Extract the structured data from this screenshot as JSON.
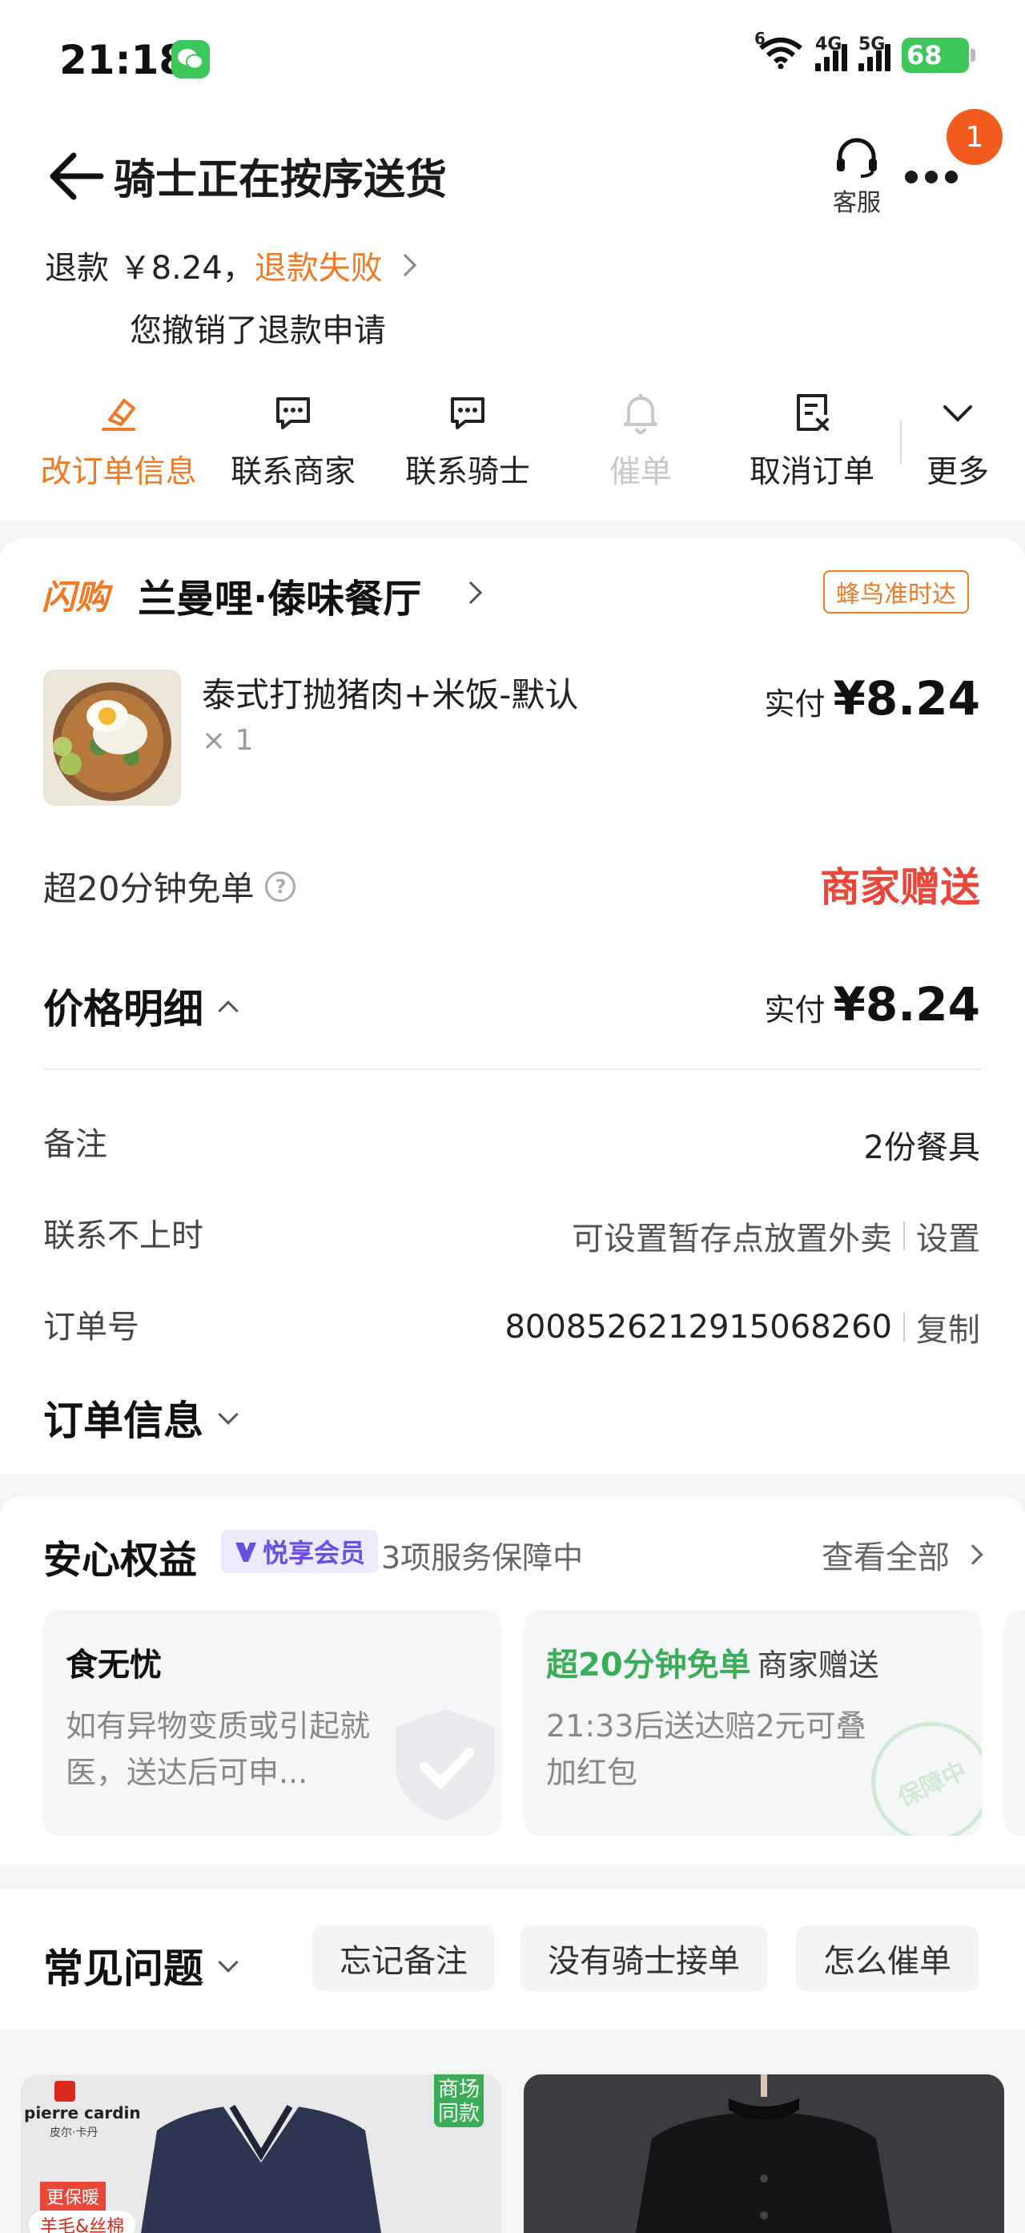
{
  "status_bar": {
    "time": "21:18",
    "signal_1_label": "6",
    "signal_2_label": "4G",
    "signal_3_label": "5G",
    "battery": "68"
  },
  "header": {
    "title": "骑士正在按序送货",
    "service_label": "客服",
    "notification_count": "1"
  },
  "refund": {
    "prefix": "退款 ￥8.24，",
    "status": "退款失败",
    "note": "您撤销了退款申请"
  },
  "actions": [
    {
      "label": "改订单信息",
      "color": "#f07a24"
    },
    {
      "label": "联系商家",
      "color": "#222222"
    },
    {
      "label": "联系骑士",
      "color": "#222222"
    },
    {
      "label": "催单",
      "color": "#c8c8c8"
    },
    {
      "label": "取消订单",
      "color": "#222222"
    },
    {
      "label": "更多",
      "color": "#222222"
    }
  ],
  "shop": {
    "tag": "闪购",
    "name": "兰曼哩·傣味餐厅",
    "badge": "蜂鸟准时达",
    "item": {
      "name": "泰式打抛猪肉+米饭-默认",
      "quantity": "× 1",
      "paid_label": "实付",
      "paid_amount": "¥8.24"
    },
    "free_offer_label": "超20分钟免单",
    "free_offer_value": "商家赠送"
  },
  "price_detail": {
    "title": "价格明细",
    "paid_label": "实付",
    "paid_amount": "¥8.24"
  },
  "details": {
    "remark_key": "备注",
    "remark_value": "2份餐具",
    "unreachable_key": "联系不上时",
    "unreachable_value": "可设置暂存点放置外卖",
    "unreachable_action": "设置",
    "order_no_key": "订单号",
    "order_no_value": "8008526212915068260",
    "order_no_action": "复制"
  },
  "order_info_title": "订单信息",
  "benefits": {
    "title": "安心权益",
    "member_badge": "悦享会员",
    "count_text": "3项服务保障中",
    "view_all": "查看全部",
    "cards": [
      {
        "title": "食无忧",
        "desc": "如有异物变质或引起就医，送达后可申..."
      },
      {
        "title": "超20分钟免单",
        "sub": "商家赠送",
        "desc": "21:33后送达赔2元可叠加红包",
        "stamp": "保障中"
      }
    ]
  },
  "faq": {
    "title": "常见问题",
    "chips": [
      "忘记备注",
      "没有骑士接单",
      "怎么催单"
    ]
  },
  "products": {
    "card1_brand": "pierre cardin",
    "card1_brand_cn": "皮尔·卡丹",
    "card1_tag": "商场同款",
    "card1_promo": "更保暖",
    "card1_material": "羊毛&丝棉"
  },
  "colors": {
    "accent_orange": "#f07a24",
    "red": "#e8473a",
    "green": "#3aae57",
    "purple": "#6b4fe0"
  }
}
